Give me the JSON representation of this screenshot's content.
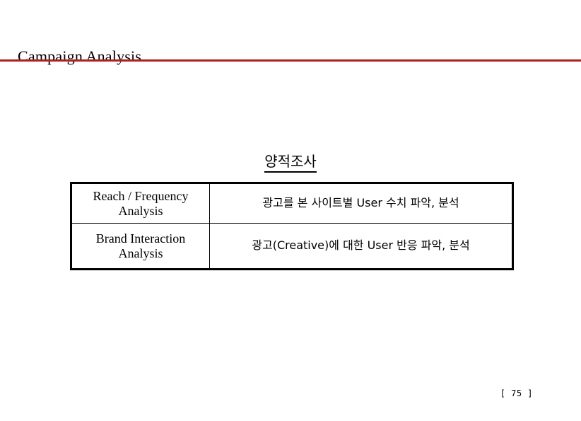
{
  "slide": {
    "title": "Campaign Analysis",
    "accent_color": "#b02020",
    "background_color": "#ffffff",
    "text_color": "#000000",
    "page_number": "[ 75 ]"
  },
  "section": {
    "header": "양적조사"
  },
  "table": {
    "rows": [
      {
        "label": "Reach / Frequency Analysis",
        "description": "광고를 본 사이트별 User 수치 파악, 분석"
      },
      {
        "label": "Brand Interaction Analysis",
        "description": "광고(Creative)에 대한 User 반응 파악, 분석"
      }
    ]
  }
}
